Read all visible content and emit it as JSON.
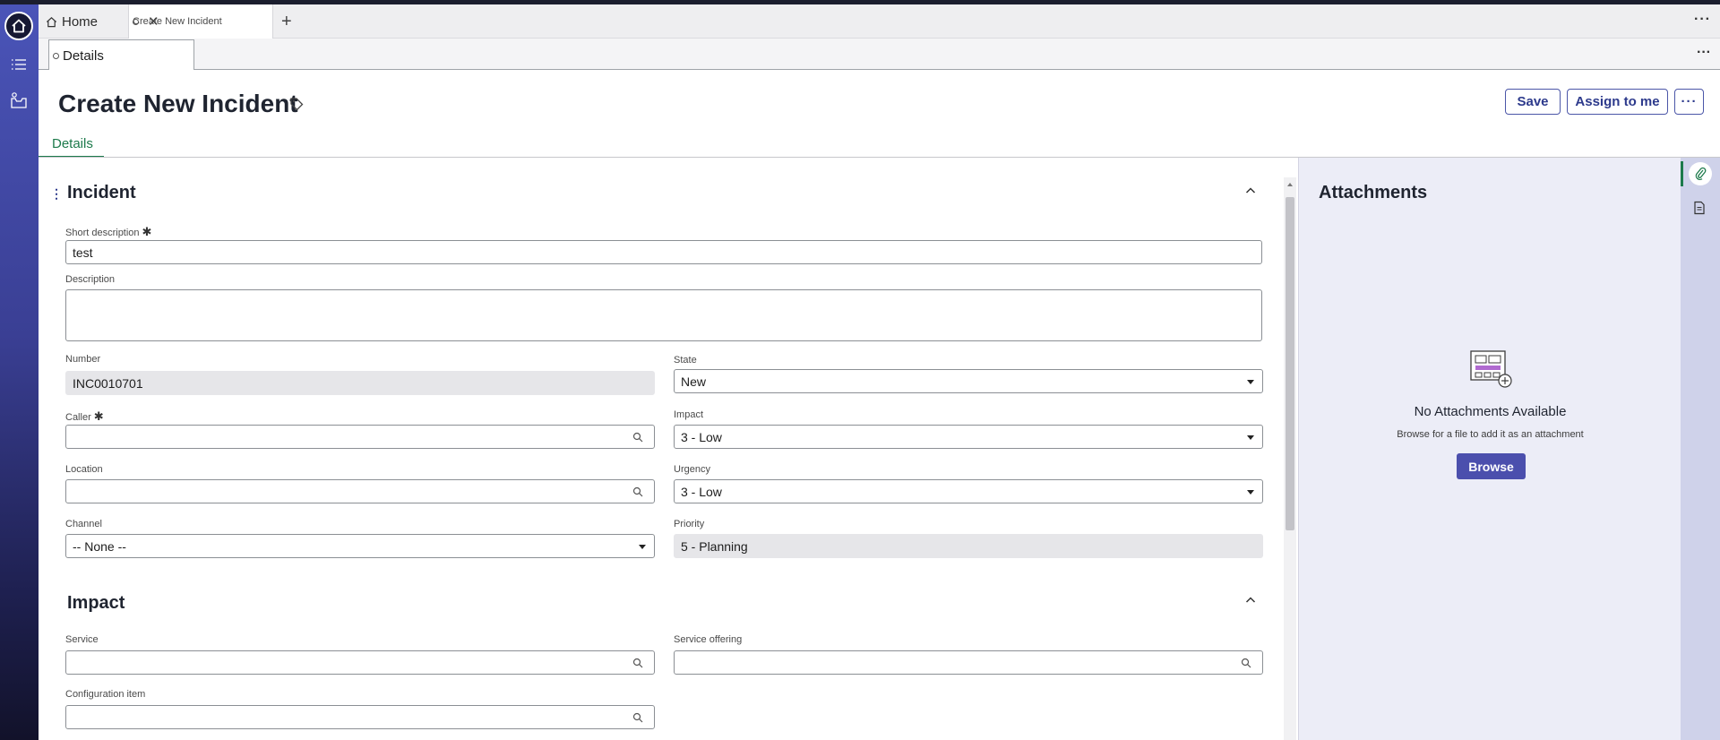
{
  "tabs": {
    "home_label": "Home",
    "active_label": "Create New Incident",
    "close": "✕",
    "add": "+",
    "more": "···"
  },
  "subtabs": {
    "details_label": "Details",
    "more": "···"
  },
  "header": {
    "title": "Create New Incident",
    "save_label": "Save",
    "assign_label": "Assign to me",
    "more_label": "···",
    "form_tab_label": "Details"
  },
  "incident": {
    "section_title": "Incident",
    "short_description": {
      "label": "Short description",
      "required": "✱",
      "value": "test"
    },
    "description": {
      "label": "Description",
      "value": ""
    },
    "number": {
      "label": "Number",
      "value": "INC0010701"
    },
    "state": {
      "label": "State",
      "value": "New"
    },
    "caller": {
      "label": "Caller",
      "required": "✱",
      "value": ""
    },
    "impact": {
      "label": "Impact",
      "value": "3 - Low"
    },
    "location": {
      "label": "Location",
      "value": ""
    },
    "urgency": {
      "label": "Urgency",
      "value": "3 - Low"
    },
    "channel": {
      "label": "Channel",
      "value": "-- None --"
    },
    "priority": {
      "label": "Priority",
      "value": "5 - Planning"
    }
  },
  "impact_section": {
    "section_title": "Impact",
    "service": {
      "label": "Service",
      "value": ""
    },
    "service_offering": {
      "label": "Service offering",
      "value": ""
    },
    "configuration_item": {
      "label": "Configuration item",
      "value": ""
    }
  },
  "attachments": {
    "title": "Attachments",
    "empty_title": "No Attachments Available",
    "hint": "Browse for a file to add it as an attachment",
    "browse_label": "Browse"
  },
  "icons": [
    "home-icon",
    "list-icon",
    "inbox-icon",
    "tag-icon",
    "search-icon",
    "chevron-up-icon",
    "paperclip-icon",
    "document-icon"
  ],
  "colors": {
    "accent": "#4b4fad",
    "active_tab_underline": "#1d7a4b",
    "rail_top": "#4a54b8",
    "rail_bottom": "#12122a"
  }
}
